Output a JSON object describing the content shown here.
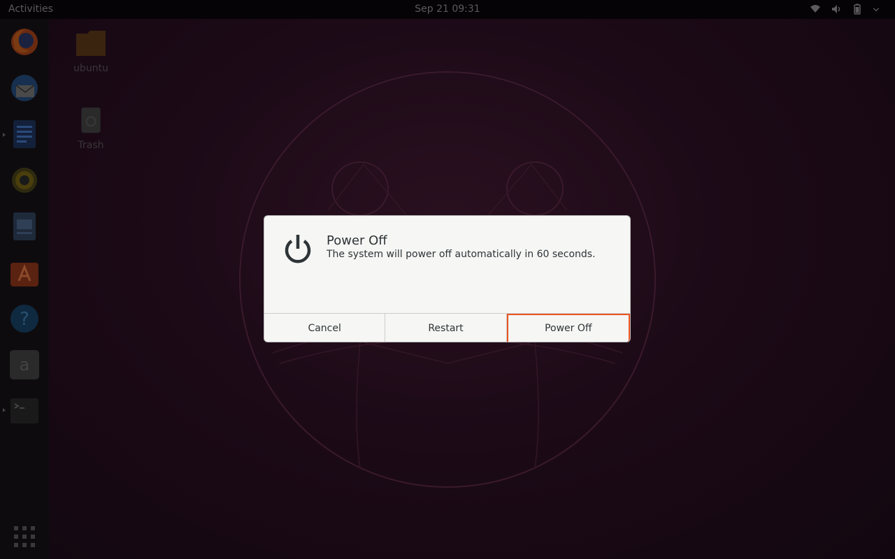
{
  "topbar": {
    "activities_label": "Activities",
    "clock": "Sep 21  09:31",
    "tray_icons": [
      "network-wifi-icon",
      "volume-icon",
      "battery-icon",
      "system-menu-chevron-icon"
    ]
  },
  "dock": {
    "items": [
      {
        "name": "firefox",
        "icon": "firefox-icon"
      },
      {
        "name": "thunderbird",
        "icon": "thunderbird-icon"
      },
      {
        "name": "libreoffice-writer",
        "icon": "writer-icon"
      },
      {
        "name": "rhythmbox",
        "icon": "rhythmbox-icon"
      },
      {
        "name": "libreoffice-impress",
        "icon": "document-icon"
      },
      {
        "name": "ubuntu-software",
        "icon": "software-center-icon"
      },
      {
        "name": "help",
        "icon": "help-icon"
      },
      {
        "name": "amazon",
        "icon": "amazon-icon"
      },
      {
        "name": "terminal",
        "icon": "terminal-icon"
      }
    ],
    "show_apps_icon": "grid-icon"
  },
  "desktop": {
    "icons": [
      {
        "label": "ubuntu",
        "icon": "home-folder-icon"
      },
      {
        "label": "Trash",
        "icon": "trash-icon"
      }
    ]
  },
  "dialog": {
    "icon": "power-icon",
    "title": "Power Off",
    "message": "The system will power off automatically in 60 seconds.",
    "buttons": {
      "cancel": "Cancel",
      "restart": "Restart",
      "power_off": "Power Off"
    },
    "focused_button": "power_off",
    "accent_color": "#e95420"
  }
}
